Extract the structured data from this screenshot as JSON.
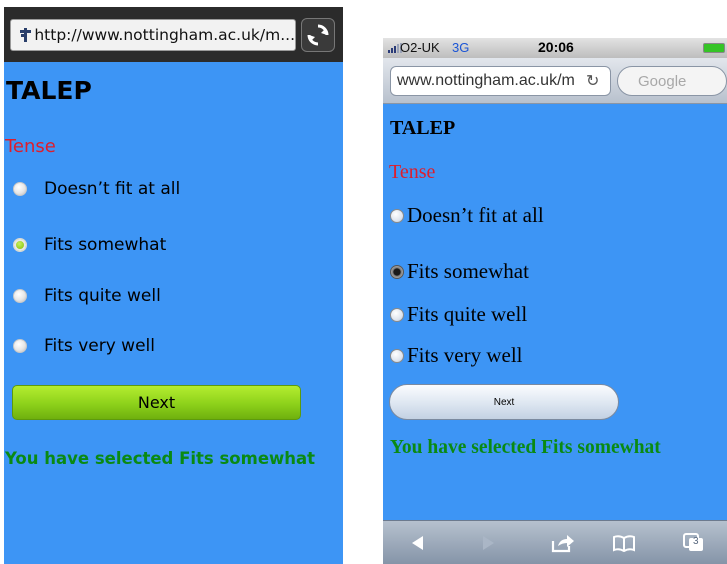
{
  "android": {
    "url": "http://www.nottingham.ac.uk/m...",
    "title": "TALEP",
    "section": "Tense",
    "options": [
      {
        "label": "Doesn’t fit at all",
        "selected": false
      },
      {
        "label": "Fits somewhat",
        "selected": true
      },
      {
        "label": "Fits quite well",
        "selected": false
      },
      {
        "label": "Fits very well",
        "selected": false
      }
    ],
    "next_label": "Next",
    "message": "You have selected Fits somewhat"
  },
  "iphone": {
    "carrier": "O2-UK",
    "network": "3G",
    "time": "20:06",
    "url": "www.nottingham.ac.uk/m",
    "search_placeholder": "Google",
    "title": "TALEP",
    "section": "Tense",
    "options": [
      {
        "label": "Doesn’t fit at all",
        "selected": false
      },
      {
        "label": "Fits somewhat",
        "selected": true
      },
      {
        "label": "Fits quite well",
        "selected": false
      },
      {
        "label": "Fits very well",
        "selected": false
      }
    ],
    "next_label": "Next",
    "message": "You have selected Fits somewhat",
    "tab_count": "3",
    "toolbar_icons": [
      "back-icon",
      "forward-icon",
      "share-icon",
      "bookmarks-icon",
      "tabs-icon"
    ]
  }
}
